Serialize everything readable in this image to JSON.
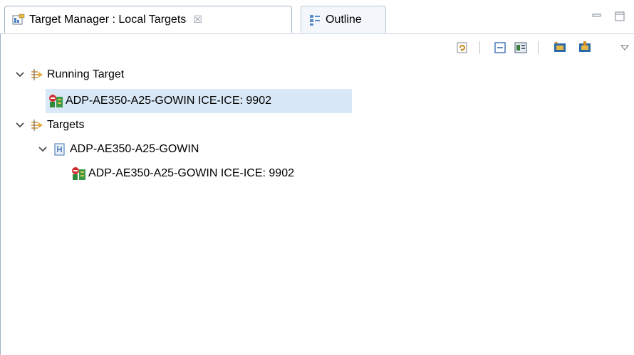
{
  "tabs": {
    "active": {
      "label": "Target Manager : Local Targets",
      "close_glyph": "☒"
    },
    "inactive": {
      "label": "Outline"
    }
  },
  "window_controls": [
    "minimize-icon",
    "maximize-icon"
  ],
  "toolbar": {
    "buttons": [
      "refresh-icon",
      "collapse-all-icon",
      "show-properties-icon",
      "connect-target-icon",
      "disconnect-target-icon",
      "view-menu-icon"
    ]
  },
  "tree": {
    "running_target": {
      "label": "Running Target",
      "children": [
        {
          "label": "ADP-AE350-A25-GOWIN ICE-ICE: 9902",
          "selected": true
        }
      ]
    },
    "targets": {
      "label": "Targets",
      "children": [
        {
          "label": "ADP-AE350-A25-GOWIN",
          "children": [
            {
              "label": "ADP-AE350-A25-GOWIN ICE-ICE: 9902"
            }
          ]
        }
      ]
    }
  },
  "colors": {
    "selection": "#d9e8f6",
    "tab_border": "#9fb3c8"
  }
}
